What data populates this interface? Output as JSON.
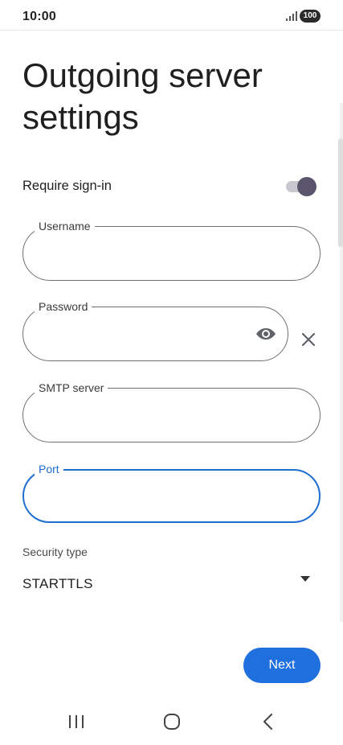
{
  "status_bar": {
    "time": "10:00",
    "battery": "100"
  },
  "page": {
    "title": "Outgoing server settings"
  },
  "require_signin": {
    "label": "Require sign-in",
    "enabled": true
  },
  "fields": {
    "username": {
      "label": "Username",
      "value": ""
    },
    "password": {
      "label": "Password",
      "value": ""
    },
    "smtp_server": {
      "label": "SMTP server",
      "value": ""
    },
    "port": {
      "label": "Port",
      "value": ""
    }
  },
  "security": {
    "caption": "Security type",
    "selected": "STARTTLS"
  },
  "actions": {
    "next_label": "Next"
  },
  "icons": {
    "signal": "signal-bars-icon",
    "eye": "eye-icon",
    "clear": "close-icon",
    "dropdown": "dropdown-arrow-icon",
    "recents": "recents-icon",
    "home": "home-icon",
    "back": "back-icon"
  },
  "colors": {
    "accent": "#1f6fde",
    "focus_outline": "#1d6ed0",
    "toggle_knob": "#5a556d"
  }
}
